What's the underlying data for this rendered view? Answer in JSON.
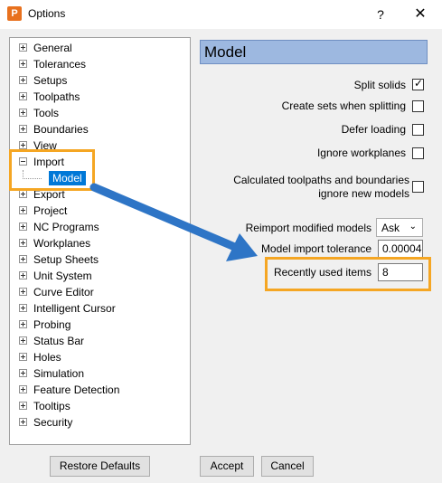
{
  "window": {
    "app_icon": "P",
    "title": "Options",
    "help_label": "?",
    "close_label": "✕"
  },
  "tree": {
    "items": [
      {
        "label": "General"
      },
      {
        "label": "Tolerances"
      },
      {
        "label": "Setups"
      },
      {
        "label": "Toolpaths"
      },
      {
        "label": "Tools"
      },
      {
        "label": "Boundaries"
      },
      {
        "label": "View"
      },
      {
        "label": "Import"
      },
      {
        "label": "Export"
      },
      {
        "label": "Project"
      },
      {
        "label": "NC Programs"
      },
      {
        "label": "Workplanes"
      },
      {
        "label": "Setup Sheets"
      },
      {
        "label": "Unit System"
      },
      {
        "label": "Curve Editor"
      },
      {
        "label": "Intelligent Cursor"
      },
      {
        "label": "Probing"
      },
      {
        "label": "Status Bar"
      },
      {
        "label": "Holes"
      },
      {
        "label": "Simulation"
      },
      {
        "label": "Feature Detection"
      },
      {
        "label": "Tooltips"
      },
      {
        "label": "Security"
      }
    ],
    "selected_child": "Model"
  },
  "panel": {
    "title": "Model",
    "options": {
      "split_solids": {
        "label": "Split solids",
        "checked": true
      },
      "create_sets": {
        "label": "Create sets when splitting",
        "checked": false
      },
      "defer_loading": {
        "label": "Defer loading",
        "checked": false
      },
      "ignore_workplanes": {
        "label": "Ignore workplanes",
        "checked": false
      },
      "calc_line1": "Calculated toolpaths and boundaries",
      "calc_line2": "ignore new models"
    },
    "reimport": {
      "label": "Reimport modified models",
      "value": "Ask"
    },
    "tolerance": {
      "label": "Model import tolerance",
      "value": "0.00004"
    },
    "recent": {
      "label": "Recently used items",
      "value": "8"
    }
  },
  "buttons": {
    "restore": "Restore Defaults",
    "accept": "Accept",
    "cancel": "Cancel"
  },
  "colors": {
    "highlight": "#f5a623",
    "arrow": "#2e75c6",
    "selection": "#0078d7",
    "header": "#9db8e0"
  }
}
